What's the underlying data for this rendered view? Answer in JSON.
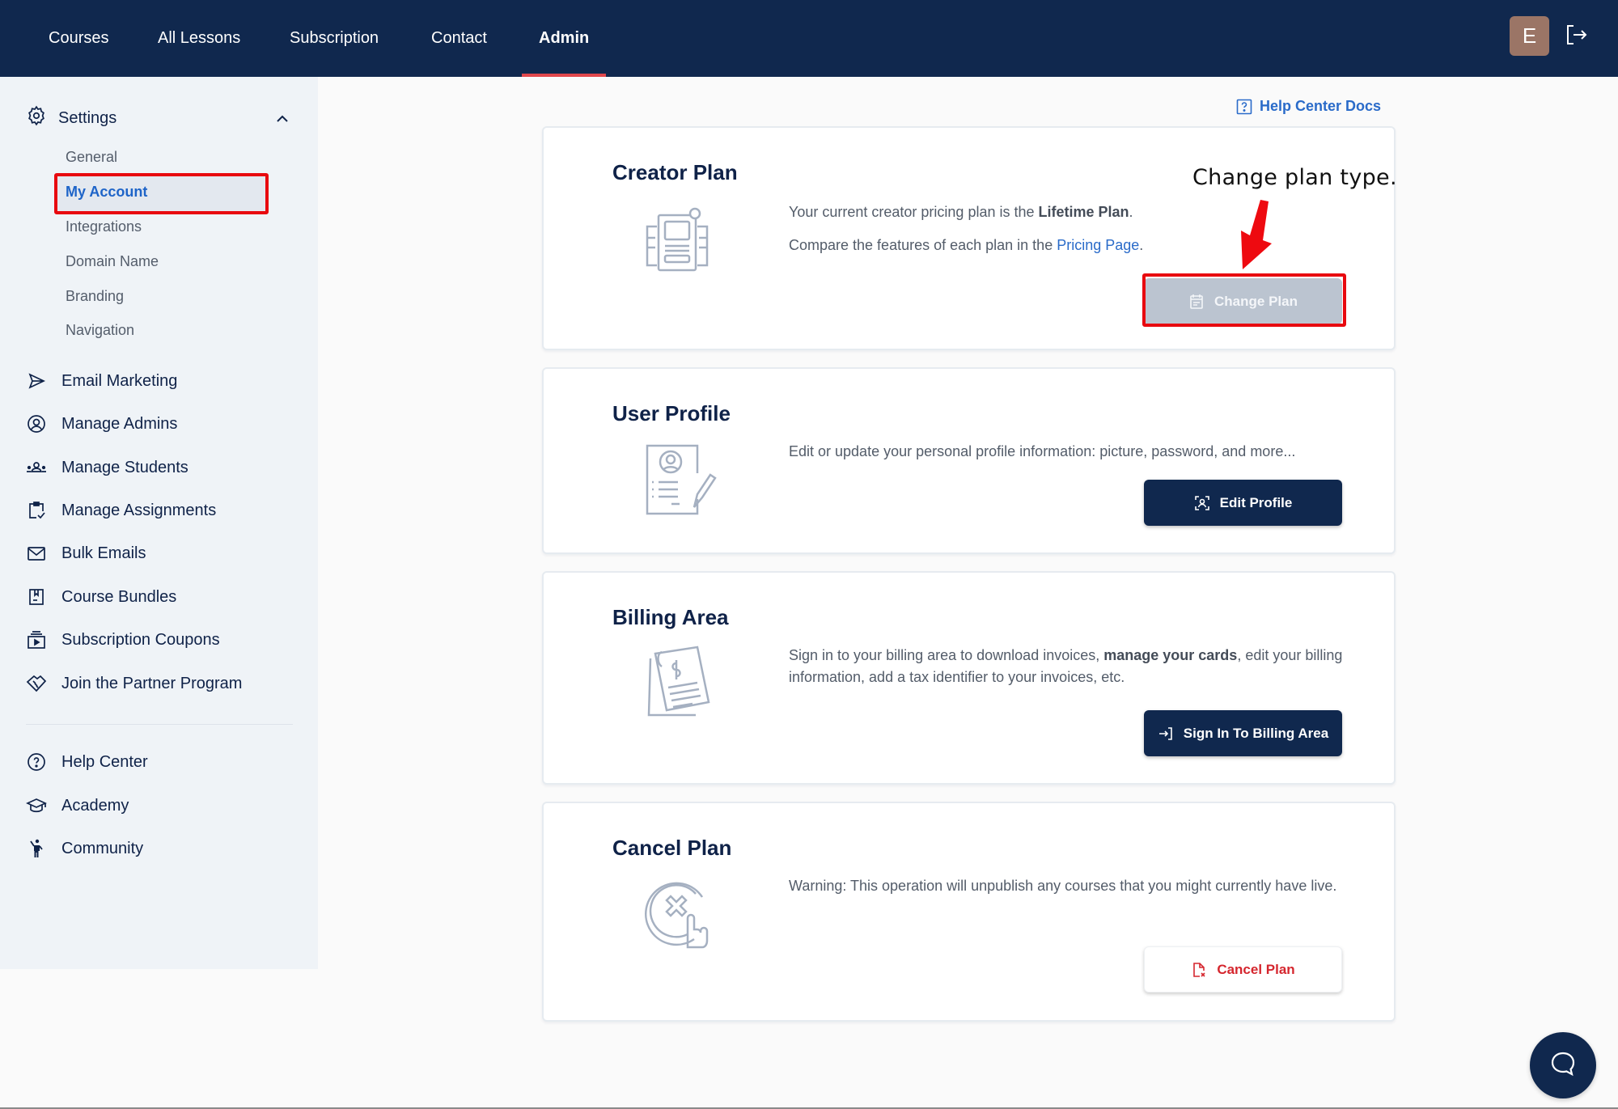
{
  "topnav": {
    "items": [
      {
        "label": "Courses",
        "active": false
      },
      {
        "label": "All Lessons",
        "active": false
      },
      {
        "label": "Subscription",
        "active": false
      },
      {
        "label": "Contact",
        "active": false
      },
      {
        "label": "Admin",
        "active": true
      }
    ],
    "avatar_initial": "E",
    "logout_icon": "logout-icon",
    "active_underline_color": "#e0474c",
    "background_color": "#10284e"
  },
  "sidebar": {
    "settings": {
      "label": "Settings",
      "icon": "gear-icon",
      "expanded": true,
      "subitems": [
        {
          "label": "General",
          "active": false
        },
        {
          "label": "My Account",
          "active": true
        },
        {
          "label": "Integrations",
          "active": false
        },
        {
          "label": "Domain Name",
          "active": false
        },
        {
          "label": "Branding",
          "active": false
        },
        {
          "label": "Navigation",
          "active": false
        }
      ]
    },
    "items": [
      {
        "label": "Email Marketing",
        "icon": "send-icon"
      },
      {
        "label": "Manage Admins",
        "icon": "user-circle-icon"
      },
      {
        "label": "Manage Students",
        "icon": "users-icon"
      },
      {
        "label": "Manage Assignments",
        "icon": "clipboard-check-icon"
      },
      {
        "label": "Bulk Emails",
        "icon": "mail-icon"
      },
      {
        "label": "Course Bundles",
        "icon": "bundle-icon"
      },
      {
        "label": "Subscription Coupons",
        "icon": "coupon-icon"
      },
      {
        "label": "Join the Partner Program",
        "icon": "handshake-icon"
      }
    ],
    "footer_items": [
      {
        "label": "Help Center",
        "icon": "question-circle-icon"
      },
      {
        "label": "Academy",
        "icon": "graduation-cap-icon"
      },
      {
        "label": "Community",
        "icon": "person-waving-icon"
      }
    ]
  },
  "main": {
    "help_docs_link": "Help Center Docs",
    "annotation": "Change plan type.",
    "cards": {
      "creator_plan": {
        "title": "Creator Plan",
        "line1_prefix": "Your current creator pricing plan is the ",
        "line1_bold": "Lifetime Plan",
        "line1_suffix": ".",
        "line2_prefix": "Compare the features of each plan in the ",
        "line2_link": "Pricing Page",
        "line2_suffix": ".",
        "button": "Change Plan",
        "button_disabled": true
      },
      "user_profile": {
        "title": "User Profile",
        "text": "Edit or update your personal profile information: picture, password, and more...",
        "button": "Edit Profile"
      },
      "billing_area": {
        "title": "Billing Area",
        "text_prefix": "Sign in to your billing area to download invoices, ",
        "text_bold": "manage your cards",
        "text_suffix": ", edit your billing information, add a tax identifier to your invoices, etc.",
        "button": "Sign In To Billing Area"
      },
      "cancel_plan": {
        "title": "Cancel Plan",
        "text": "Warning: This operation will unpublish any courses that you might currently have live.",
        "button": "Cancel Plan"
      }
    },
    "chat_icon": "chat-bubble-icon"
  }
}
